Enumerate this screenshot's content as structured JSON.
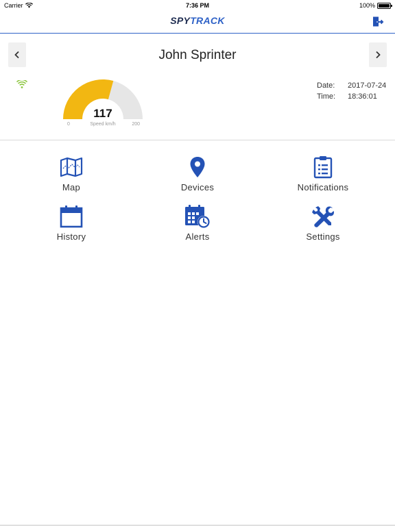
{
  "status_bar": {
    "carrier": "Carrier",
    "time": "7:36 PM",
    "battery_percent": "100%",
    "battery_level": 1.0
  },
  "header": {
    "logo_part1": "SPY",
    "logo_part2": "TRACK",
    "logout_icon": "logout-door-icon"
  },
  "driver": {
    "name": "John Sprinter",
    "prev_icon": "chevron-left-icon",
    "next_icon": "chevron-right-icon"
  },
  "speed": {
    "value": "117",
    "numeric_value": 117,
    "label": "Speed km/h",
    "min": "0",
    "max": "200",
    "min_value": 0,
    "max_value": 200
  },
  "info": {
    "date_label": "Date:",
    "date_value": "2017-07-24",
    "time_label": "Time:",
    "time_value": "18:36:01"
  },
  "menu": {
    "map": "Map",
    "devices": "Devices",
    "notifications": "Notifications",
    "history": "History",
    "alerts": "Alerts",
    "settings": "Settings"
  },
  "colors": {
    "accent": "#2f62c7",
    "gauge_fill": "#f2b712",
    "gauge_track": "#e6e6e6",
    "signal": "#8cc63f",
    "icon": "#2452b5"
  }
}
